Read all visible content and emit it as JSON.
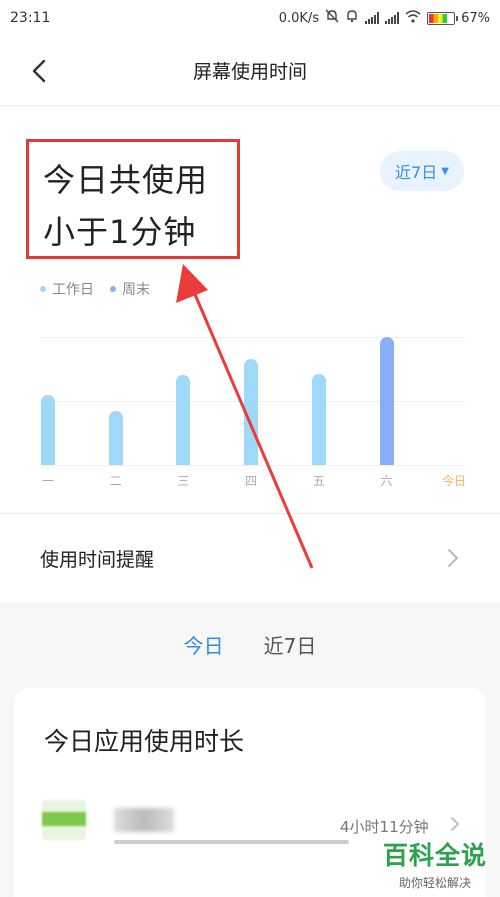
{
  "status_bar": {
    "time": "23:11",
    "net_speed": "0.0K/s",
    "battery": "67%"
  },
  "header": {
    "title": "屏幕使用时间",
    "back_icon": "chevron-left-icon"
  },
  "summary": {
    "line1": "今日共使用",
    "line2": "小于1分钟",
    "range_button": "近7日",
    "highlight_color": "#e53935"
  },
  "legend": {
    "weekday": "工作日",
    "weekend": "周末",
    "weekday_color": "#9fd8f8",
    "weekend_color": "#8aaef5"
  },
  "chart_data": {
    "type": "bar",
    "categories": [
      "一",
      "二",
      "三",
      "四",
      "五",
      "六",
      "今日"
    ],
    "values": [
      0.55,
      0.42,
      0.7,
      0.83,
      0.71,
      1.0,
      0
    ],
    "kinds": [
      "weekday",
      "weekday",
      "weekday",
      "weekday",
      "weekday",
      "weekend",
      "today"
    ],
    "today_label_color": "#f5b25a",
    "grid": true
  },
  "reminder": {
    "label": "使用时间提醒"
  },
  "tabs": [
    {
      "label": "今日",
      "active": true
    },
    {
      "label": "近7日",
      "active": false
    }
  ],
  "apps_card": {
    "heading": "今日应用使用时长",
    "items": [
      {
        "time": "4小时11分钟"
      }
    ]
  },
  "watermark": {
    "main": "百科全说",
    "sub": "助你轻松解决"
  }
}
